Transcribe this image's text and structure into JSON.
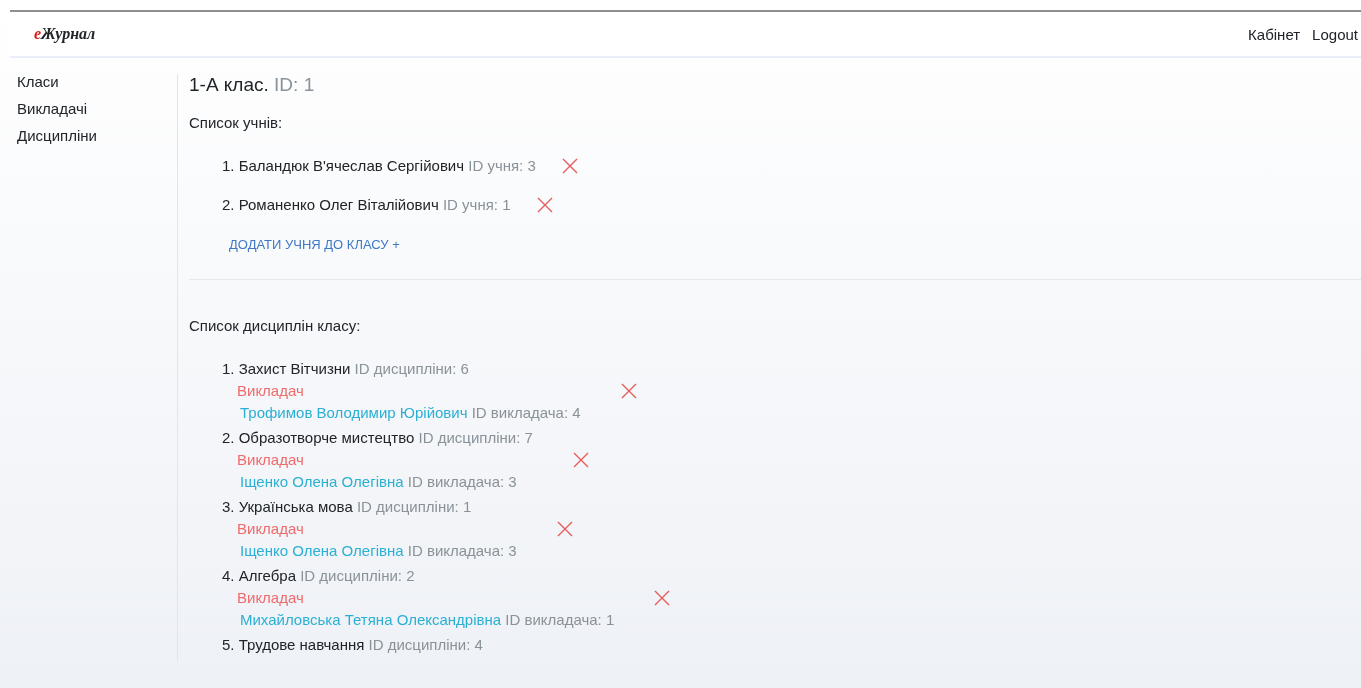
{
  "header": {
    "logo_accent": "е",
    "logo_text": "Журнал",
    "links": [
      "Кабінет",
      "Logout"
    ]
  },
  "sidebar": {
    "items": [
      "Класи",
      "Викладачі",
      "Дисципліни"
    ]
  },
  "class": {
    "title": "1-А клас.",
    "id_label": "ID: 1"
  },
  "students": {
    "heading": "Список учнів:",
    "items": [
      {
        "name": "1. Баландюк В'ячеслав Сергійович",
        "id_label": "ID учня: 3"
      },
      {
        "name": "2. Романенко Олег Віталійович",
        "id_label": "ID учня: 1"
      }
    ],
    "add_link": "ДОДАТИ УЧНЯ ДО КЛАСУ +"
  },
  "disciplines": {
    "heading": "Список дисциплін класу:",
    "items": [
      {
        "name": "1. Захист Вітчизни",
        "id_label": "ID дисципліни: 6",
        "teacher_label": "Викладач",
        "teacher": "Трофимов Володимир Юрійович",
        "teacher_id_label": "ID викладача: 4"
      },
      {
        "name": "2. Образотворче мистецтво",
        "id_label": "ID дисципліни: 7",
        "teacher_label": "Викладач",
        "teacher": "Іщенко Олена Олегівна",
        "teacher_id_label": "ID викладача: 3"
      },
      {
        "name": "3. Українська мова",
        "id_label": "ID дисципліни: 1",
        "teacher_label": "Викладач",
        "teacher": "Іщенко Олена Олегівна",
        "teacher_id_label": "ID викладача: 3"
      },
      {
        "name": "4. Алгебра",
        "id_label": "ID дисципліни: 2",
        "teacher_label": "Викладач",
        "teacher": "Михайловська Тетяна Олександрівна",
        "teacher_id_label": "ID викладача: 1"
      },
      {
        "name": "5. Трудове навчання",
        "id_label": "ID дисципліни: 4"
      }
    ]
  }
}
